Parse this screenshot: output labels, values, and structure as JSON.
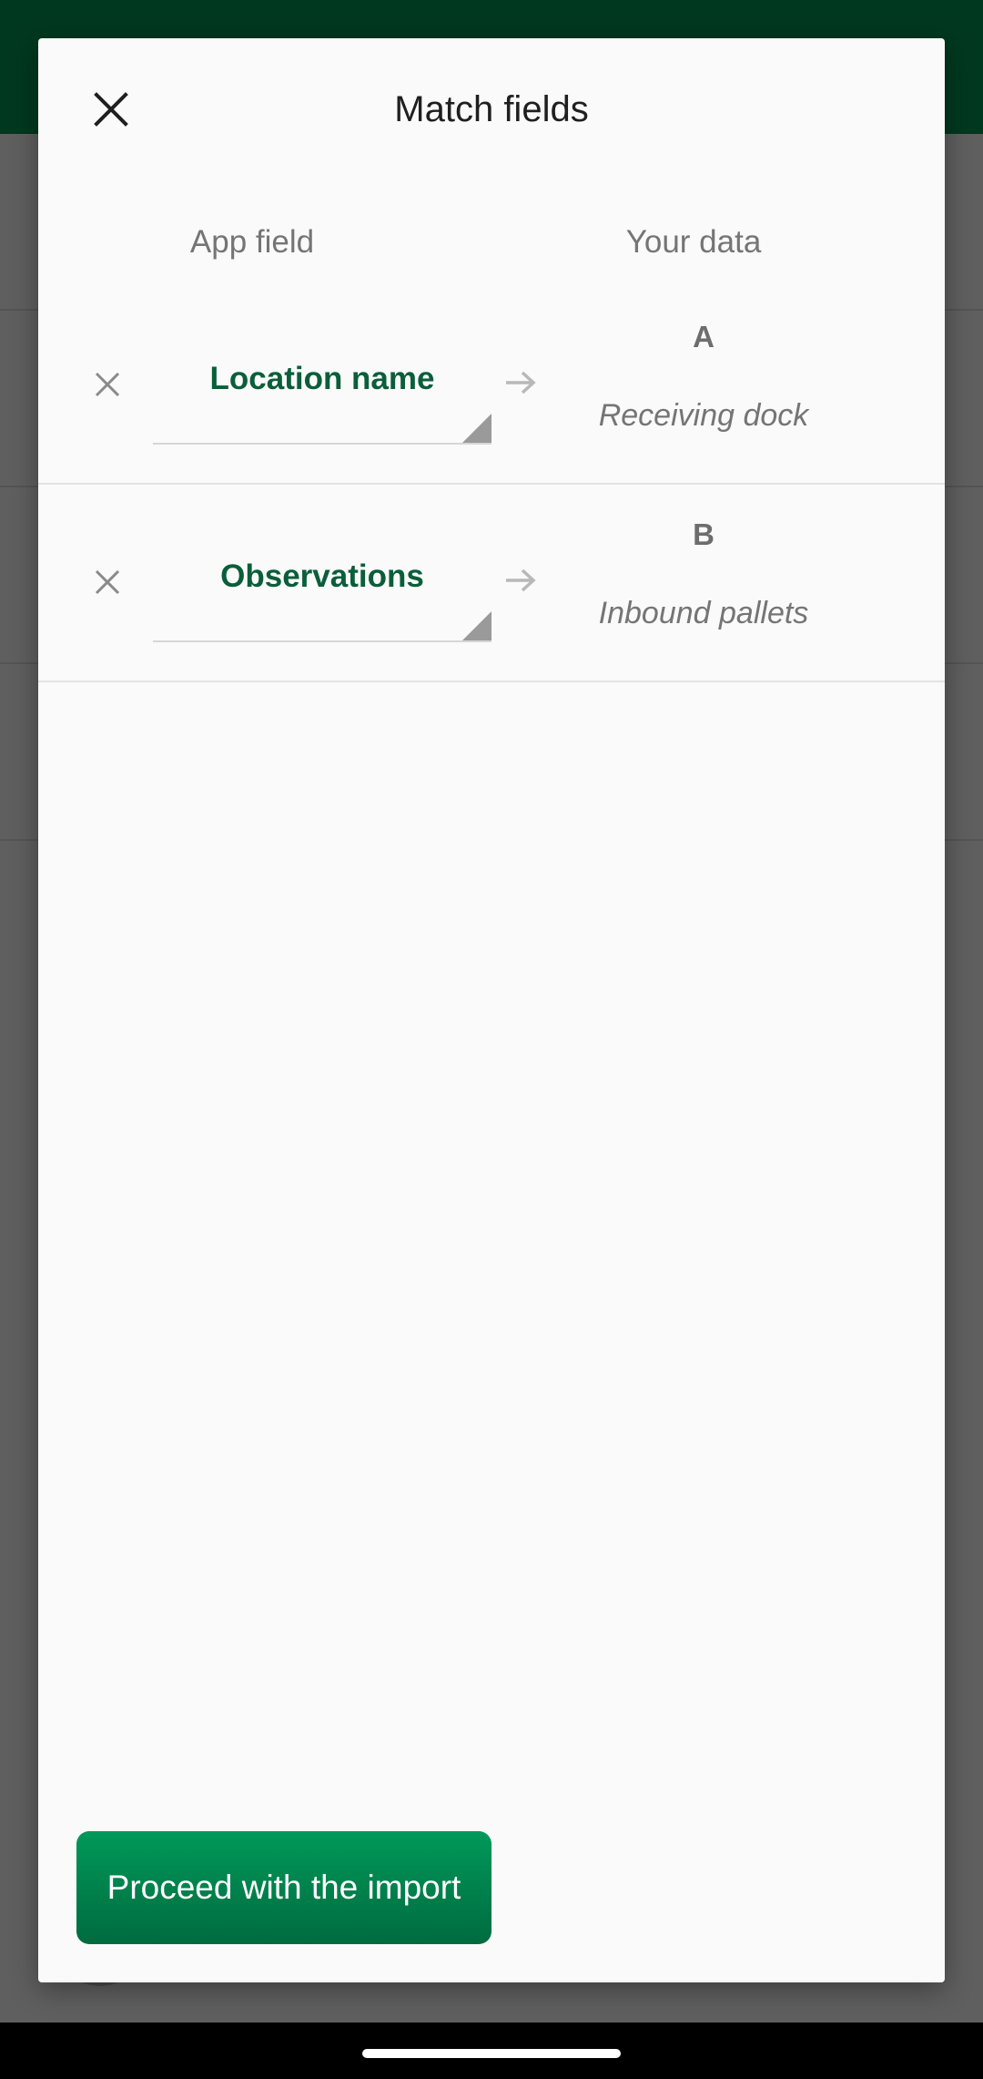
{
  "dialog": {
    "title": "Match fields",
    "close_icon": "close-icon",
    "columns": {
      "app_field": "App field",
      "your_data": "Your data"
    },
    "mappings": [
      {
        "app_field": "Location name",
        "source_column": "A",
        "sample_value": "Receiving dock"
      },
      {
        "app_field": "Observations",
        "source_column": "B",
        "sample_value": "Inbound pallets"
      }
    ],
    "proceed_label": "Proceed with the import"
  },
  "colors": {
    "app_bar": "#00381f",
    "accent_text": "#0b5e3a",
    "button_top": "#00995a",
    "button_bottom": "#006b3f"
  }
}
